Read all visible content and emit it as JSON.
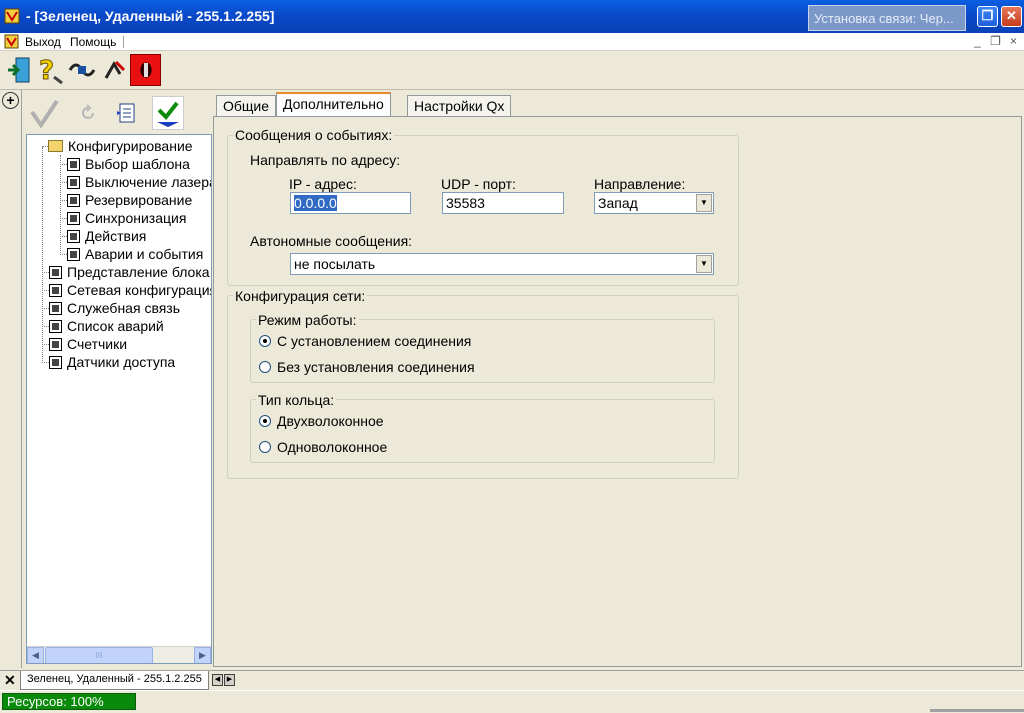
{
  "window": {
    "title": "- [Зеленец, Удаленный - 255.1.2.255]",
    "popup": "Установка связи: Чер...",
    "buttons": {
      "minimize": "–",
      "restore": "❐",
      "close": "✕"
    }
  },
  "menu": {
    "items": [
      "Выход",
      "Помощь"
    ],
    "mdi_buttons": [
      "_",
      "❐",
      "×"
    ]
  },
  "toolbar": {
    "buttons": [
      {
        "icon": "exit-door-icon"
      },
      {
        "icon": "help-question-icon"
      },
      {
        "icon": "connect-plug-icon"
      },
      {
        "icon": "disconnect-icon"
      },
      {
        "icon": "alarm-red-icon"
      }
    ]
  },
  "tree_toolbar": {
    "buttons": [
      {
        "icon": "check-gray-icon"
      },
      {
        "icon": "refresh-gray-icon"
      },
      {
        "icon": "document-list-icon"
      },
      {
        "icon": "apply-check-icon"
      }
    ]
  },
  "tree": {
    "items": [
      {
        "label": "Конфигурирование",
        "level": 0,
        "kind": "folder"
      },
      {
        "label": "Выбор шаблона",
        "level": 1,
        "kind": "leaf"
      },
      {
        "label": "Выключение лазера",
        "level": 1,
        "kind": "leaf"
      },
      {
        "label": "Резервирование",
        "level": 1,
        "kind": "leaf"
      },
      {
        "label": "Синхронизация",
        "level": 1,
        "kind": "leaf"
      },
      {
        "label": "Действия",
        "level": 1,
        "kind": "leaf"
      },
      {
        "label": "Аварии и события",
        "level": 1,
        "kind": "leaf"
      },
      {
        "label": "Представление блока",
        "level": 0,
        "kind": "leaf"
      },
      {
        "label": "Сетевая конфигурация",
        "level": 0,
        "kind": "leaf"
      },
      {
        "label": "Служебная связь",
        "level": 0,
        "kind": "leaf"
      },
      {
        "label": "Список аварий",
        "level": 0,
        "kind": "leaf"
      },
      {
        "label": "Счетчики",
        "level": 0,
        "kind": "leaf"
      },
      {
        "label": "Датчики доступа",
        "level": 0,
        "kind": "leaf"
      }
    ],
    "scroll_grip": "III"
  },
  "tabs": [
    {
      "label": "Общие",
      "active": false
    },
    {
      "label": "Дополнительно",
      "active": true
    },
    {
      "label": "Настройки Qx",
      "active": false
    }
  ],
  "events": {
    "legend": "Сообщения о событиях:",
    "address_label": "Направлять по адресу:",
    "ip_label": "IP - адрес:",
    "ip_value": "0.0.0.0",
    "udp_label": "UDP - порт:",
    "udp_value": "35583",
    "direction_label": "Направление:",
    "direction_value": "Запад",
    "autonomous_label": "Автономные сообщения:",
    "autonomous_value": "не посылать"
  },
  "network": {
    "legend": "Конфигурация сети:",
    "mode": {
      "legend": "Режим работы:",
      "options": [
        {
          "label": "С установлением соединения",
          "checked": true
        },
        {
          "label": "Без установления соединения",
          "checked": false
        }
      ]
    },
    "ring": {
      "legend": "Тип кольца:",
      "options": [
        {
          "label": "Двухволоконное",
          "checked": true
        },
        {
          "label": "Одноволоконное",
          "checked": false
        }
      ]
    }
  },
  "doc_tabs": {
    "close": "✕",
    "tab": "Зеленец, Удаленный - 255.1.2.255",
    "nav": [
      "◀",
      "▶"
    ]
  },
  "status": {
    "resources": "Ресурсов: 100%"
  }
}
